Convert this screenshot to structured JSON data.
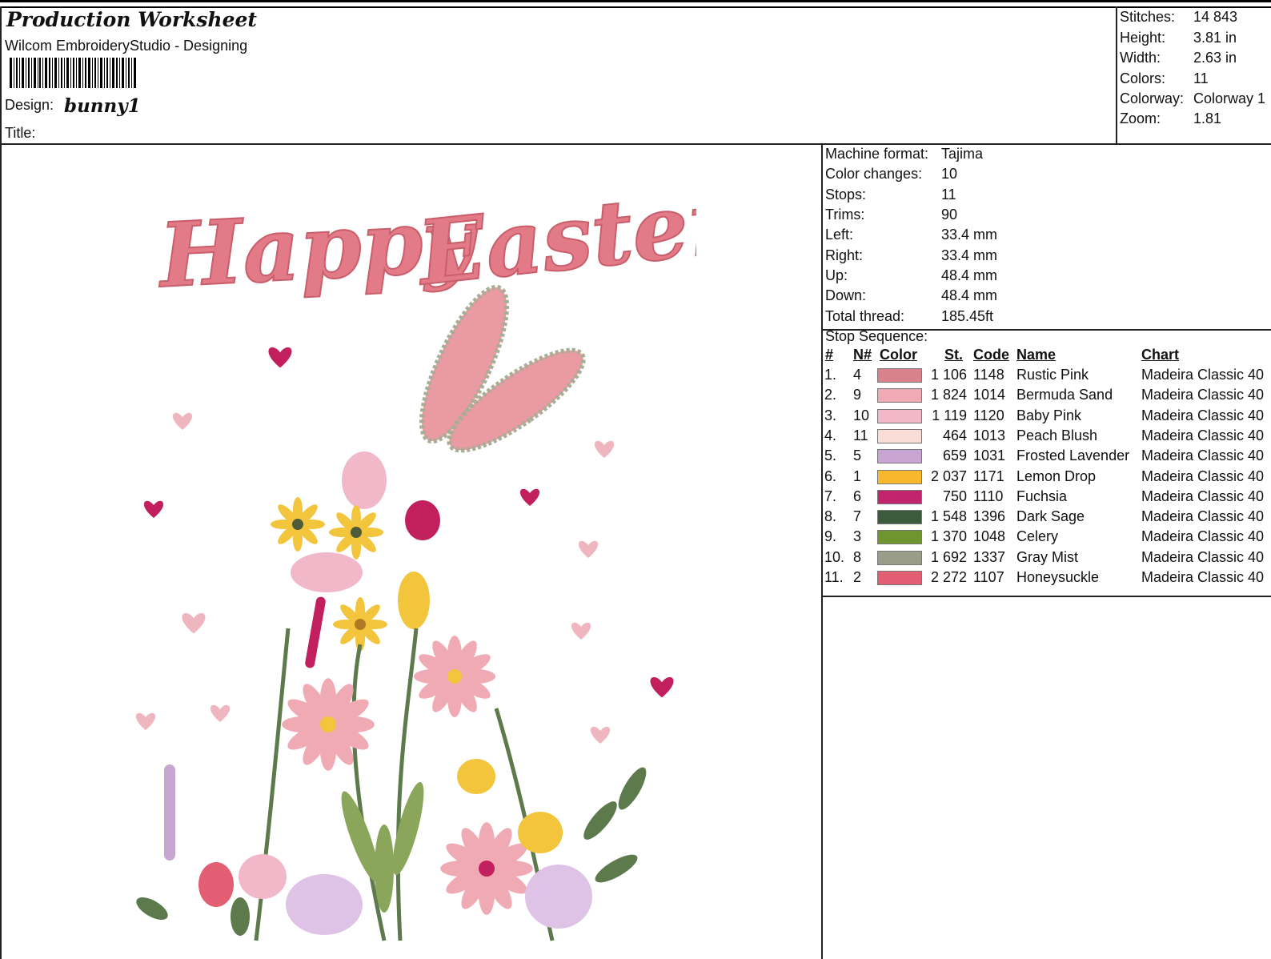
{
  "header": {
    "title": "Production Worksheet",
    "subtitle": "Wilcom EmbroideryStudio - Designing",
    "design_label": "Design:",
    "design_value": "bunny1",
    "title_label": "Title:",
    "title_value": ""
  },
  "summary": [
    {
      "label": "Stitches:",
      "value": "14 843"
    },
    {
      "label": "Height:",
      "value": "3.81 in"
    },
    {
      "label": "Width:",
      "value": "2.63 in"
    },
    {
      "label": "Colors:",
      "value": "11"
    },
    {
      "label": "Colorway:",
      "value": "Colorway 1"
    },
    {
      "label": "Zoom:",
      "value": "1.81"
    }
  ],
  "machine": [
    {
      "label": "Machine format:",
      "value": "Tajima"
    },
    {
      "label": "Color changes:",
      "value": "10"
    },
    {
      "label": "Stops:",
      "value": "11"
    },
    {
      "label": "Trims:",
      "value": "90"
    },
    {
      "label": "Left:",
      "value": "33.4 mm"
    },
    {
      "label": "Right:",
      "value": "33.4 mm"
    },
    {
      "label": "Up:",
      "value": "48.4 mm"
    },
    {
      "label": "Down:",
      "value": "48.4 mm"
    },
    {
      "label": "Total thread:",
      "value": "185.45ft"
    }
  ],
  "stop_sequence": {
    "title": "Stop Sequence:",
    "headers": {
      "num": "#",
      "n": "N#",
      "color": "Color",
      "st": "St.",
      "code": "Code",
      "name": "Name",
      "chart": "Chart"
    },
    "rows": [
      {
        "num": "1.",
        "n": "4",
        "color": "#d9828c",
        "st": "1 106",
        "code": "1148",
        "name": "Rustic Pink",
        "chart": "Madeira Classic 40"
      },
      {
        "num": "2.",
        "n": "9",
        "color": "#efaab4",
        "st": "1 824",
        "code": "1014",
        "name": "Bermuda Sand",
        "chart": "Madeira Classic 40"
      },
      {
        "num": "3.",
        "n": "10",
        "color": "#f1b8ca",
        "st": "1 119",
        "code": "1120",
        "name": "Baby Pink",
        "chart": "Madeira Classic 40"
      },
      {
        "num": "4.",
        "n": "11",
        "color": "#f8dcd6",
        "st": "464",
        "code": "1013",
        "name": "Peach Blush",
        "chart": "Madeira Classic 40"
      },
      {
        "num": "5.",
        "n": "5",
        "color": "#c9a5d3",
        "st": "659",
        "code": "1031",
        "name": "Frosted Lavender",
        "chart": "Madeira Classic 40"
      },
      {
        "num": "6.",
        "n": "1",
        "color": "#f8b72c",
        "st": "2 037",
        "code": "1171",
        "name": "Lemon Drop",
        "chart": "Madeira Classic 40"
      },
      {
        "num": "7.",
        "n": "6",
        "color": "#c2246e",
        "st": "750",
        "code": "1110",
        "name": "Fuchsia",
        "chart": "Madeira Classic 40"
      },
      {
        "num": "8.",
        "n": "7",
        "color": "#3c5a3e",
        "st": "1 548",
        "code": "1396",
        "name": "Dark Sage",
        "chart": "Madeira Classic 40"
      },
      {
        "num": "9.",
        "n": "3",
        "color": "#6f962e",
        "st": "1 370",
        "code": "1048",
        "name": "Celery",
        "chart": "Madeira Classic 40"
      },
      {
        "num": "10.",
        "n": "8",
        "color": "#999d89",
        "st": "1 692",
        "code": "1337",
        "name": "Gray Mist",
        "chart": "Madeira Classic 40"
      },
      {
        "num": "11.",
        "n": "2",
        "color": "#e45e73",
        "st": "2 272",
        "code": "1107",
        "name": "Honeysuckle",
        "chart": "Madeira Classic 40"
      }
    ]
  },
  "artwork": {
    "text_lines": [
      "Happy",
      "Easter"
    ],
    "colors": {
      "script": "#e27b87",
      "heart_dark": "#c21f5e",
      "heart_light": "#f0b6c0",
      "leaf": "#5c7a4c",
      "stem": "#8aa65a",
      "yellow": "#f3c53c",
      "lavender": "#c8a6d2"
    }
  }
}
